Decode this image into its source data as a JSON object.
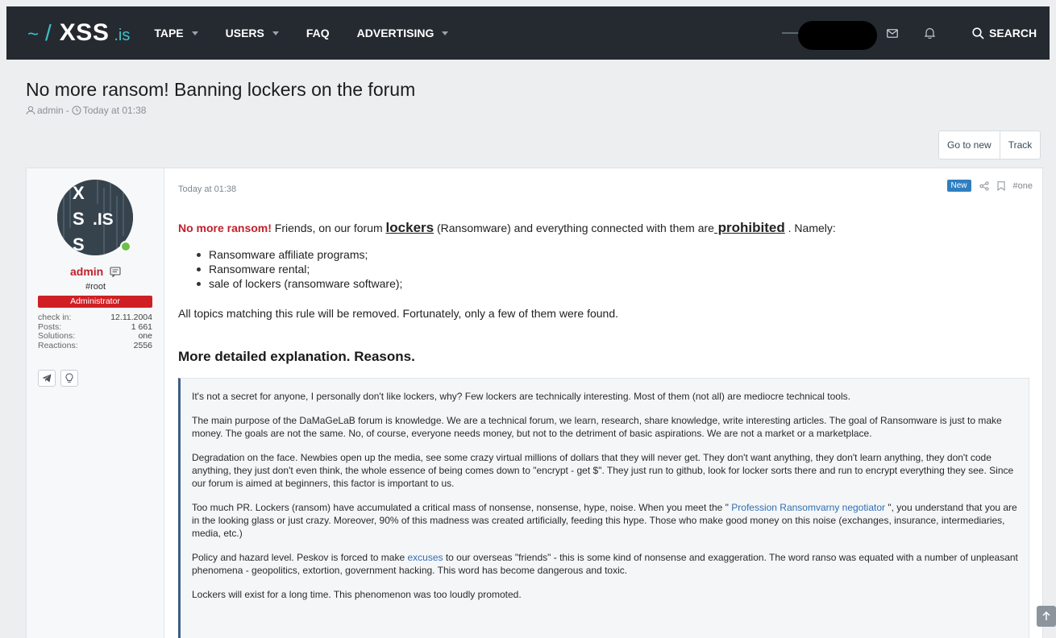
{
  "site": {
    "tilde": "~",
    "slash": "/",
    "name": "XSS",
    "tld": ".is"
  },
  "nav": [
    {
      "label": "TAPE",
      "dropdown": true
    },
    {
      "label": "USERS",
      "dropdown": true
    },
    {
      "label": "FAQ",
      "dropdown": false
    },
    {
      "label": "ADVERTISING",
      "dropdown": true
    }
  ],
  "header": {
    "search_label": "SEARCH",
    "icons": [
      "mail-icon",
      "bell-icon",
      "search-icon"
    ]
  },
  "thread": {
    "title": "No more ransom! Banning lockers on the forum",
    "author": "admin",
    "separator": "-",
    "time": "Today at 01:38",
    "go_to_new": "Go to new",
    "track": "Track"
  },
  "user": {
    "avatar_text": [
      "X",
      "S",
      ".IS",
      "S"
    ],
    "name": "admin",
    "title": "#root",
    "badge": "Administrator",
    "stats": [
      {
        "label": "check in:",
        "value": "12.11.2004"
      },
      {
        "label": "Posts:",
        "value": "1 661"
      },
      {
        "label": "Solutions:",
        "value": "one"
      },
      {
        "label": "Reactions:",
        "value": "2556"
      }
    ]
  },
  "post": {
    "time": "Today at 01:38",
    "new_tag": "New",
    "anchor": "#one",
    "lead": {
      "red": "No more ransom!",
      "t1": " Friends, on our forum ",
      "b1": "lockers",
      "t2": " (Ransomware) and everything connected with them are",
      "b2": " prohibited",
      "t3": " . Namely:"
    },
    "list": [
      "Ransomware affiliate programs;",
      "Ransomware rental;",
      "sale of lockers (ransomware software);"
    ],
    "removed": "All topics matching this rule will be removed. Fortunately, only a few of them were found.",
    "heading": "More detailed explanation. Reasons.",
    "quote": {
      "p1": "It's not a secret for anyone, I personally don't like lockers, why? Few lockers are technically interesting. Most of them (not all) are mediocre technical tools.",
      "p2": "The main purpose of the DaMaGeLaB forum is knowledge. We are a technical forum, we learn, research, share knowledge, write interesting articles. The goal of Ransomware is just to make money. The goals are not the same. No, of course, everyone needs money, but not to the detriment of basic aspirations. We are not a market or a marketplace.",
      "p3": "Degradation on the face. Newbies open up the media, see some crazy virtual millions of dollars that they will never get. They don't want anything, they don't learn anything, they don't code anything, they just don't even think, the whole essence of being comes down to \"encrypt - get $\". They just run to github, look for locker sorts there and run to encrypt everything they see. Since our forum is aimed at beginners, this factor is important to us.",
      "p4a": "Too much PR. Lockers (ransom) have accumulated a critical mass of nonsense, nonsense, hype, noise. When you meet the \" ",
      "p4link": "Profession Ransomvarny negotiator",
      "p4b": " \", you understand that you are in the looking glass or just crazy. Moreover, 90% of this madness was created artificially, feeding this hype. Those who make good money on this noise (exchanges, insurance, intermediaries, media, etc.)",
      "p5a": "Policy and hazard level. Peskov is forced to make ",
      "p5link": "excuses",
      "p5b": " to our overseas \"friends\" - this is some kind of nonsense and exaggeration. The word ranso was equated with a number of unpleasant phenomena - geopolitics, extortion, government hacking. This word has become dangerous and toxic.",
      "p6": "Lockers will exist for a long time. This phenomenon was too loudly promoted."
    }
  },
  "colors": {
    "header_bg": "#252a31",
    "accent": "#3fc1c9",
    "admin_red": "#c0212b",
    "badge_red": "#d01f24",
    "new_blue": "#2f7fc0",
    "quote_border": "#3d5e86"
  }
}
